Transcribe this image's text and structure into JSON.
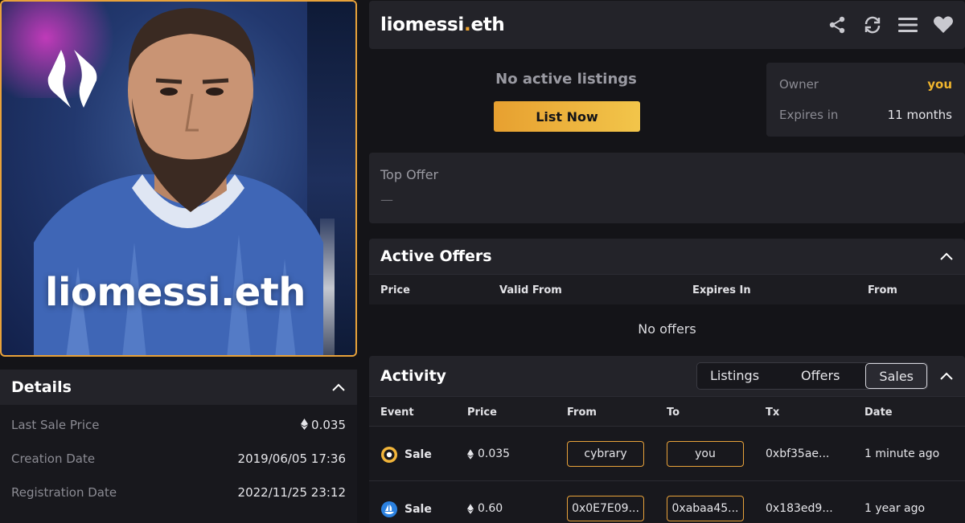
{
  "domain_name": "liomessi.eth",
  "hero": {
    "name": "liomessi.eth"
  },
  "details": {
    "title": "Details",
    "rows": [
      {
        "label": "Last Sale Price",
        "value": "0.035"
      },
      {
        "label": "Creation Date",
        "value": "2019/06/05 17:36"
      },
      {
        "label": "Registration Date",
        "value": "2022/11/25 23:12"
      }
    ]
  },
  "header": {
    "name_base": "liomessi",
    "name_dot": ".",
    "name_tld": "eth",
    "icons": [
      "share-icon",
      "refresh-icon",
      "menu-icon",
      "heart-icon"
    ]
  },
  "listing": {
    "status": "No active listings",
    "button": "List Now"
  },
  "owner": {
    "owner_label": "Owner",
    "owner_value": "you",
    "expires_label": "Expires in",
    "expires_value": "11 months"
  },
  "top_offer": {
    "label": "Top Offer",
    "value": "—"
  },
  "active_offers": {
    "title": "Active Offers",
    "columns": [
      "Price",
      "Valid From",
      "Expires In",
      "From"
    ],
    "empty": "No offers"
  },
  "activity": {
    "title": "Activity",
    "tabs": [
      "Listings",
      "Offers",
      "Sales"
    ],
    "active_tab": "Sales",
    "columns": [
      "Event",
      "Price",
      "From",
      "To",
      "Tx",
      "Date"
    ],
    "rows": [
      {
        "event": "Sale",
        "price": "0.035",
        "from": "cybrary",
        "to": "you",
        "tx": "0xbf35ae...",
        "date": "1 minute ago"
      },
      {
        "event": "Sale",
        "price": "0.60",
        "from": "0x0E7E09...",
        "to": "0xabaa45...",
        "tx": "0x183ed9...",
        "date": "1 year ago"
      }
    ]
  },
  "colors": {
    "accent": "#e8a23a",
    "gold_text": "#f0b52d",
    "panel": "#232329",
    "background": "#141418"
  }
}
